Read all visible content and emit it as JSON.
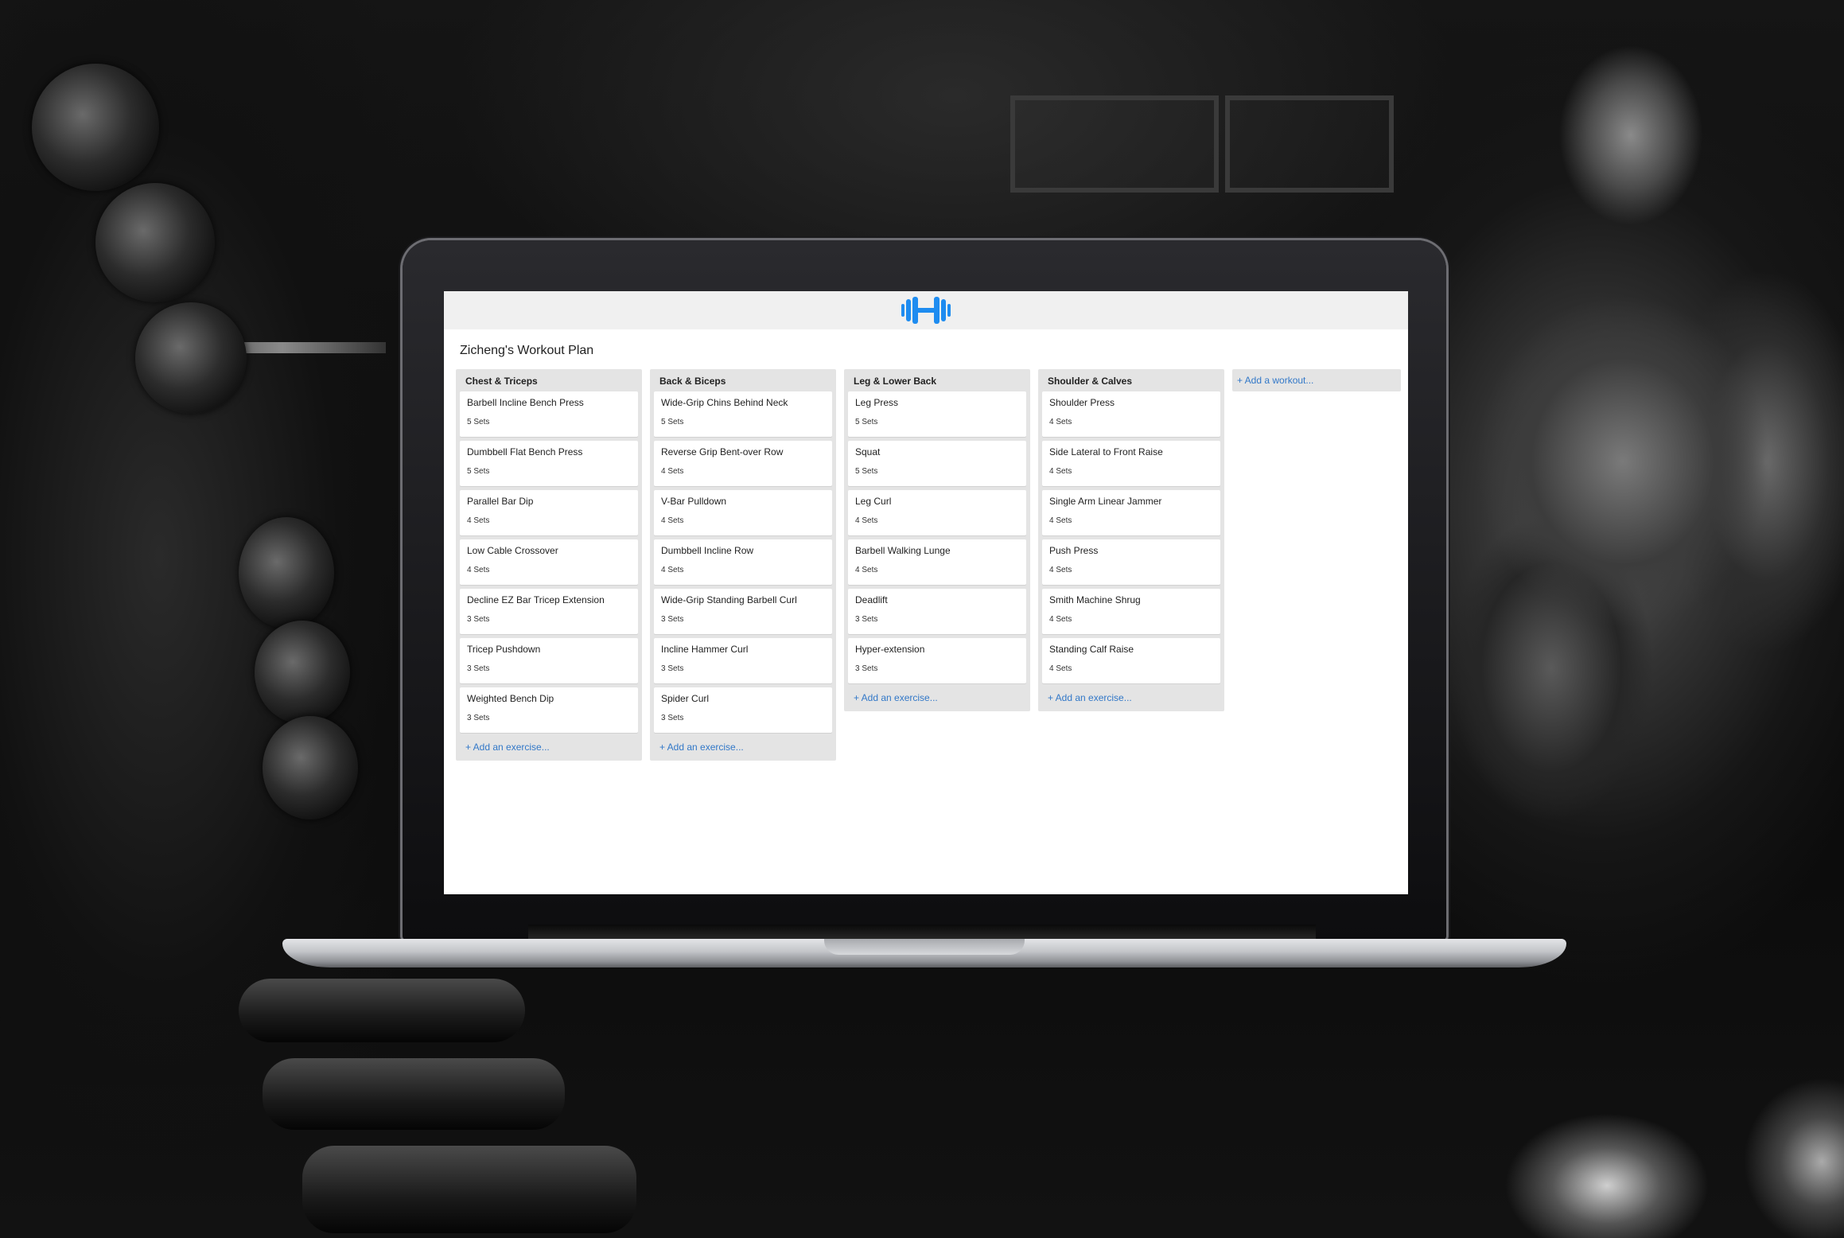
{
  "app": {
    "logo_icon": "dumbbell-icon",
    "accent_color": "#1e8cf0",
    "plan_title": "Zicheng's Workout Plan",
    "add_workout_label": "+ Add a workout..."
  },
  "lists": [
    {
      "title": "Chest & Triceps",
      "add_label": "+ Add an exercise...",
      "cards": [
        {
          "name": "Barbell Incline Bench Press",
          "sets": "5 Sets"
        },
        {
          "name": "Dumbbell Flat Bench Press",
          "sets": "5 Sets"
        },
        {
          "name": "Parallel Bar Dip",
          "sets": "4 Sets"
        },
        {
          "name": "Low Cable Crossover",
          "sets": "4 Sets"
        },
        {
          "name": "Decline EZ Bar Tricep Extension",
          "sets": "3 Sets"
        },
        {
          "name": "Tricep Pushdown",
          "sets": "3 Sets"
        },
        {
          "name": "Weighted Bench Dip",
          "sets": "3 Sets"
        }
      ]
    },
    {
      "title": "Back & Biceps",
      "add_label": "+ Add an exercise...",
      "cards": [
        {
          "name": "Wide-Grip Chins Behind Neck",
          "sets": "5 Sets"
        },
        {
          "name": "Reverse Grip Bent-over Row",
          "sets": "4 Sets"
        },
        {
          "name": "V-Bar Pulldown",
          "sets": "4 Sets"
        },
        {
          "name": "Dumbbell Incline Row",
          "sets": "4 Sets"
        },
        {
          "name": "Wide-Grip Standing Barbell Curl",
          "sets": "3 Sets"
        },
        {
          "name": "Incline Hammer Curl",
          "sets": "3 Sets"
        },
        {
          "name": "Spider Curl",
          "sets": "3 Sets"
        }
      ]
    },
    {
      "title": "Leg & Lower Back",
      "add_label": "+ Add an exercise...",
      "cards": [
        {
          "name": "Leg Press",
          "sets": "5 Sets"
        },
        {
          "name": "Squat",
          "sets": "5 Sets"
        },
        {
          "name": "Leg Curl",
          "sets": "4 Sets"
        },
        {
          "name": "Barbell Walking Lunge",
          "sets": "4 Sets"
        },
        {
          "name": "Deadlift",
          "sets": "3 Sets"
        },
        {
          "name": "Hyper-extension",
          "sets": "3 Sets"
        }
      ]
    },
    {
      "title": "Shoulder & Calves",
      "add_label": "+ Add an exercise...",
      "cards": [
        {
          "name": "Shoulder Press",
          "sets": "4 Sets"
        },
        {
          "name": "Side Lateral to Front Raise",
          "sets": "4 Sets"
        },
        {
          "name": "Single Arm Linear Jammer",
          "sets": "4 Sets"
        },
        {
          "name": "Push Press",
          "sets": "4 Sets"
        },
        {
          "name": "Smith Machine Shrug",
          "sets": "4 Sets"
        },
        {
          "name": "Standing Calf Raise",
          "sets": "4 Sets"
        }
      ]
    }
  ]
}
